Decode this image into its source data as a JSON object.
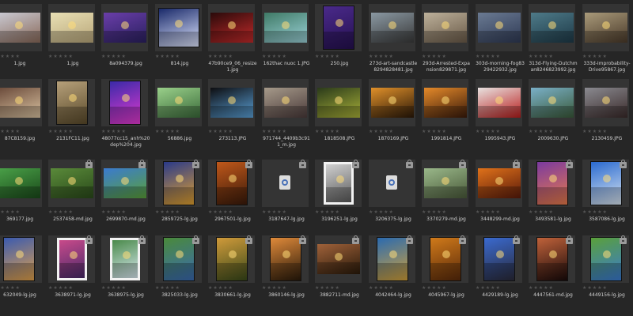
{
  "app": {
    "background": "#262626"
  },
  "rating_glyphs": "★★★★★",
  "grid": {
    "rows": [
      [
        {
          "file": "1.jpg",
          "c": "#c9c9d2",
          "c2": "#8a6a5a",
          "orient": "landscape",
          "lock": false
        },
        {
          "file": "1.jpg",
          "c": "#e8dfb4",
          "c2": "#b9a77a",
          "orient": "landscape",
          "lock": false
        },
        {
          "file": "8a094379.jpg",
          "c": "#6a3ea8",
          "c2": "#2a2060",
          "orient": "landscape",
          "lock": false
        },
        {
          "file": "814.jpg",
          "c": "#1a2a6a",
          "c2": "#dfe6ff",
          "orient": "square",
          "lock": false
        },
        {
          "file": "47b90ce9_06_resize1.jpg",
          "c": "#2a0a0a",
          "c2": "#c22a2a",
          "orient": "landscape",
          "lock": false
        },
        {
          "file": "162thac nuoc 1.JPG",
          "c": "#3f7a66",
          "c2": "#9ad0d6",
          "orient": "landscape",
          "lock": false
        },
        {
          "file": "250.jpg",
          "c": "#4a2a8a",
          "c2": "#251050",
          "orient": "portrait",
          "lock": false
        },
        {
          "file": "273d-art-sandcastle8294828481.jpg",
          "c": "#8a98a2",
          "c2": "#3a3a3a",
          "orient": "landscape",
          "lock": false
        },
        {
          "file": "293d-Arrested-Expansion829871.jpg",
          "c": "#bcb09a",
          "c2": "#6a5a48",
          "orient": "landscape",
          "lock": false
        },
        {
          "file": "303d-morning-fog8329422932.jpg",
          "c": "#6a7a92",
          "c2": "#2f3a55",
          "orient": "landscape",
          "lock": false
        },
        {
          "file": "313d-Flying-Dutchman8246823992.jpg",
          "c": "#4e7a88",
          "c2": "#1e3a48",
          "orient": "landscape",
          "lock": false
        },
        {
          "file": "333d-Improbability-Drive95867.jpg",
          "c": "#a99a7a",
          "c2": "#4a3a2a",
          "orient": "landscape",
          "lock": false
        }
      ],
      [
        {
          "file": "87C8159.jpg",
          "c": "#6a4a3a",
          "c2": "#d9c2a0",
          "orient": "landscape",
          "lock": false
        },
        {
          "file": "2131FC11.jpg",
          "c": "#b6a07a",
          "c2": "#5a4a2a",
          "orient": "portrait",
          "lock": false
        },
        {
          "file": "48077cc15_anh%20dep%204.jpg",
          "c": "#3a2aa8",
          "c2": "#e43ad0",
          "orient": "portrait",
          "lock": false
        },
        {
          "file": "56886.jpg",
          "c": "#9ad08a",
          "c2": "#3a6a3a",
          "orient": "landscape",
          "lock": false
        },
        {
          "file": "273113.JPG",
          "c": "#0d0d10",
          "c2": "#5aa0d6",
          "orient": "landscape",
          "lock": false
        },
        {
          "file": "971744_4409b3c911_m.jpg",
          "c": "#a69a8a",
          "c2": "#4a3a3a",
          "orient": "landscape",
          "lock": false
        },
        {
          "file": "1818508.JPG",
          "c": "#2a3a1a",
          "c2": "#a8b038",
          "orient": "landscape",
          "lock": false
        },
        {
          "file": "1870169.JPG",
          "c": "#e0902a",
          "c2": "#2a1808",
          "orient": "landscape",
          "lock": false
        },
        {
          "file": "1991814.JPG",
          "c": "#e58a2a",
          "c2": "#3a1a0a",
          "orient": "landscape",
          "lock": false
        },
        {
          "file": "1995943.JPG",
          "c": "#e8e2e0",
          "c2": "#b81c1c",
          "orient": "landscape",
          "lock": false
        },
        {
          "file": "2009630.JPG",
          "c": "#7ab0c8",
          "c2": "#3a5a3a",
          "orient": "landscape",
          "lock": false
        },
        {
          "file": "2130459.JPG",
          "c": "#8a8a90",
          "c2": "#3a2a2a",
          "orient": "landscape",
          "lock": false
        }
      ],
      [
        {
          "file": "369177.jpg",
          "c": "#4aa048",
          "c2": "#1a4a1a",
          "orient": "landscape",
          "lock": false
        },
        {
          "file": "2537458-md.jpg",
          "c": "#5a8a3a",
          "c2": "#2a4a1a",
          "orient": "landscape",
          "lock": true
        },
        {
          "file": "2699870-md.jpg",
          "c": "#3a7ad0",
          "c2": "#5aa03a",
          "orient": "landscape",
          "lock": true
        },
        {
          "file": "2859725-lg.jpg",
          "c": "#2a3a8a",
          "c2": "#e0a030",
          "orient": "portrait",
          "lock": true
        },
        {
          "file": "2967501-lg.jpg",
          "c": "#c0581a",
          "c2": "#3a1a0a",
          "orient": "portrait",
          "lock": true
        },
        {
          "file": "3187647-lg.jpg",
          "c": "",
          "c2": "",
          "orient": "missing",
          "lock": true
        },
        {
          "file": "3196251-lg.jpg",
          "c": "#d0d0d0",
          "c2": "#5a5a5a",
          "orient": "portrait-white",
          "lock": true
        },
        {
          "file": "3206375-lg.jpg",
          "c": "",
          "c2": "",
          "orient": "missing",
          "lock": true
        },
        {
          "file": "3370279-md.jpg",
          "c": "#9ab88a",
          "c2": "#4a5a3a",
          "orient": "landscape",
          "lock": true
        },
        {
          "file": "3448299-md.jpg",
          "c": "#e0721a",
          "c2": "#5a1a0a",
          "orient": "landscape",
          "lock": true
        },
        {
          "file": "3493581-lg.jpg",
          "c": "#7a3aa0",
          "c2": "#e87a4a",
          "orient": "portrait",
          "lock": true
        },
        {
          "file": "3587086-lg.jpg",
          "c": "#2a6ad0",
          "c2": "#d8e4f0",
          "orient": "portrait",
          "lock": true
        }
      ],
      [
        {
          "file": "632049-lg.jpg",
          "c": "#3a5ab0",
          "c2": "#e0a04a",
          "orient": "portrait",
          "lock": false
        },
        {
          "file": "3638971-lg.jpg",
          "c": "#c84a8a",
          "c2": "#4a2a6a",
          "orient": "portrait-white",
          "lock": true
        },
        {
          "file": "3638975-lg.jpg",
          "c": "#4a8a4a",
          "c2": "#d8e8f0",
          "orient": "portrait-white",
          "lock": true
        },
        {
          "file": "3825033-lg.jpg",
          "c": "#4a8a3a",
          "c2": "#3a6ab0",
          "orient": "portrait",
          "lock": true
        },
        {
          "file": "3830661-lg.jpg",
          "c": "#d09a3a",
          "c2": "#3a4a1a",
          "orient": "portrait",
          "lock": true
        },
        {
          "file": "3860146-lg.jpg",
          "c": "#e08a3a",
          "c2": "#2a1a0a",
          "orient": "portrait",
          "lock": true
        },
        {
          "file": "3882711-md.jpg",
          "c": "#a0623a",
          "c2": "#2a1a0a",
          "orient": "landscape",
          "lock": true
        },
        {
          "file": "4042464-lg.jpg",
          "c": "#2a6ab0",
          "c2": "#d0a03a",
          "orient": "portrait",
          "lock": true
        },
        {
          "file": "4045967-lg.jpg",
          "c": "#d07a1a",
          "c2": "#5a2a0a",
          "orient": "portrait",
          "lock": true
        },
        {
          "file": "4429189-lg.jpg",
          "c": "#3a6ad0",
          "c2": "#2a2a3a",
          "orient": "portrait",
          "lock": true
        },
        {
          "file": "4447561-md.jpg",
          "c": "#c0623a",
          "c2": "#1a0a0a",
          "orient": "portrait",
          "lock": true
        },
        {
          "file": "4449156-lg.jpg",
          "c": "#5aa03a",
          "c2": "#3a7ad0",
          "orient": "portrait",
          "lock": true
        }
      ]
    ]
  }
}
